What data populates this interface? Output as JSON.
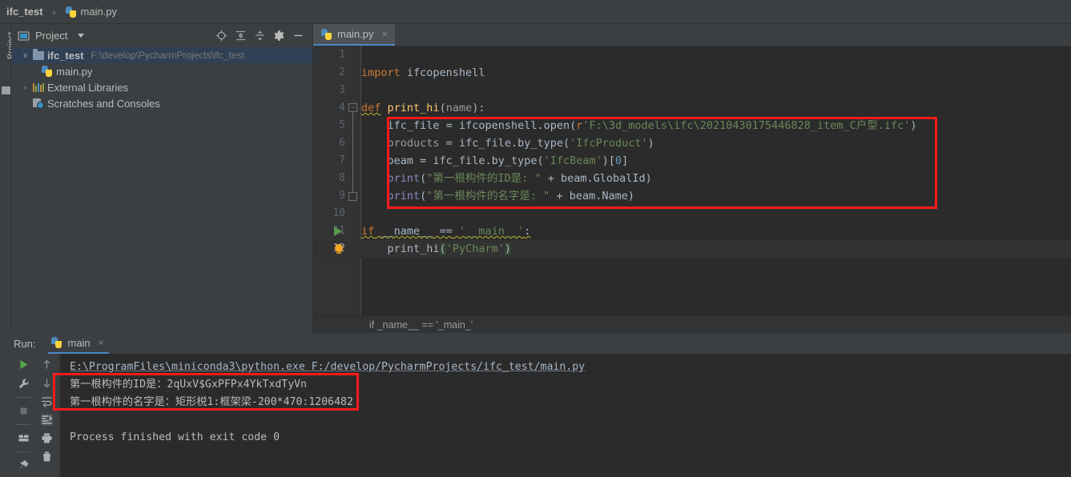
{
  "navbar": {
    "project_crumb": "ifc_test",
    "separator": "›",
    "file_crumb": "main.py",
    "file_icon": "python-file-icon"
  },
  "left_strip": {
    "label": "Project"
  },
  "project_panel": {
    "title": "Project",
    "title_icon": "project-view-icon",
    "caret": "chevron-down-icon",
    "toolbar_icons": [
      "locate-target-icon",
      "expand-all-icon",
      "collapse-all-icon",
      "gear-icon",
      "hide-minimize-icon"
    ],
    "tree": [
      {
        "arrow": "∨",
        "icon": "folder-icon",
        "label": "ifc_test",
        "path": "F:\\develop\\PycharmProjects\\ifc_test",
        "selected": true,
        "bold": true
      },
      {
        "arrow": "",
        "icon": "python-file-icon",
        "label": "main.py",
        "path": "",
        "selected": false,
        "bold": false
      },
      {
        "arrow": "›",
        "icon": "library-icon",
        "label": "External Libraries",
        "path": "",
        "selected": false,
        "bold": false
      },
      {
        "arrow": "",
        "icon": "scratches-icon",
        "label": "Scratches and Consoles",
        "path": "",
        "selected": false,
        "bold": false
      }
    ]
  },
  "editor": {
    "tab": {
      "label": "main.py",
      "icon": "python-file-icon",
      "close": "×"
    },
    "breadcrumb": "if _name__ == '_main_'",
    "lines": [
      {
        "num": "1",
        "text": ""
      },
      {
        "num": "2",
        "text": "import ifcopenshell"
      },
      {
        "num": "3",
        "text": ""
      },
      {
        "num": "4",
        "text": "def print_hi(name):"
      },
      {
        "num": "5",
        "text": "    ifc_file = ifcopenshell.open(r'F:\\3d_models\\ifc\\20210430175446828_item_C户型.ifc')"
      },
      {
        "num": "6",
        "text": "    products = ifc_file.by_type('IfcProduct')"
      },
      {
        "num": "7",
        "text": "    beam = ifc_file.by_type('IfcBeam')[0]"
      },
      {
        "num": "8",
        "text": "    print(\"第一根构件的ID是: \" + beam.GlobalId)"
      },
      {
        "num": "9",
        "text": "    print(\"第一根构件的名字是: \" + beam.Name)"
      },
      {
        "num": "10",
        "text": ""
      },
      {
        "num": "11",
        "text": "if __name__ == '__main__':"
      },
      {
        "num": "12",
        "text": "    print_hi('PyCharm')"
      }
    ],
    "code_tokens": {
      "l2_kw": "import",
      "l2_mod": " ifcopenshell",
      "l4_kw": "def",
      "l4_fn": "print_hi",
      "l4_param": "name",
      "l5_var": "ifc_file",
      "l5_call": "ifcopenshell.open",
      "l5_rprefix": "r",
      "l5_str": "'F:\\3d_models\\ifc\\20210430175446828_item_C户型.ifc'",
      "l6_var": "products",
      "l6_call": "ifc_file.by_type",
      "l6_str": "'IfcProduct'",
      "l7_var": "beam",
      "l7_call": "ifc_file.by_type",
      "l7_str": "'IfcBeam'",
      "l7_idx": "0",
      "l8_fn": "print",
      "l8_str": "\"第一根构件的ID是: \"",
      "l8_attr": "beam.GlobalId",
      "l9_fn": "print",
      "l9_str": "\"第一根构件的名字是: \"",
      "l9_attr": "beam.Name",
      "l11_kw": "if",
      "l11_dunder": "__name__",
      "l11_op": "==",
      "l11_str": "'__main__'",
      "l12_fn": "print_hi",
      "l12_str": "'PyCharm'"
    },
    "gutter": {
      "run_arrow_line": "11",
      "bulb_line": "12",
      "fold_line_start": "4",
      "fold_line_end": "9",
      "current_line": "12"
    }
  },
  "run_window": {
    "label": "Run:",
    "tab": {
      "label": "main",
      "icon": "python-run-icon",
      "close": "×"
    },
    "toolbar_left": [
      "rerun-play-icon",
      "wrench-settings-icon",
      "stop-icon",
      "layout-icon",
      "pin-icon"
    ],
    "toolbar_right": [
      "arrow-up-icon",
      "arrow-down-icon",
      "soft-wrap-icon",
      "scroll-to-end-icon",
      "print-icon",
      "trash-icon"
    ],
    "console_lines": [
      {
        "text": "E:\\ProgramFiles\\miniconda3\\python.exe F:/develop/PycharmProjects/ifc_test/main.py",
        "style": "link"
      },
      {
        "text": "第一根构件的ID是：2qUxV$GxPFPx4YkTxdTyVn",
        "style": "out"
      },
      {
        "text": "第一根构件的名字是：矩形棁1:框架梁-200*470:1206482",
        "style": "out"
      },
      {
        "text": "",
        "style": "out"
      },
      {
        "text": "Process finished with exit code 0",
        "style": "out"
      }
    ]
  },
  "annotations": [
    {
      "name": "code-highlight-box",
      "color": "#FF1A1A"
    },
    {
      "name": "console-output-highlight-box",
      "color": "#FF1A1A"
    }
  ],
  "colors": {
    "keyword": "#CC7832",
    "function": "#FFC66D",
    "string": "#6A8759",
    "number": "#6897BB",
    "identifier": "#A9B7C6",
    "gray_var": "#9B9B9B",
    "editor_bg": "#2B2B2B",
    "panel_bg": "#3C3F41",
    "selection": "#2F4055",
    "accent": "#4A88C7",
    "annotation_red": "#FF1A1A"
  }
}
